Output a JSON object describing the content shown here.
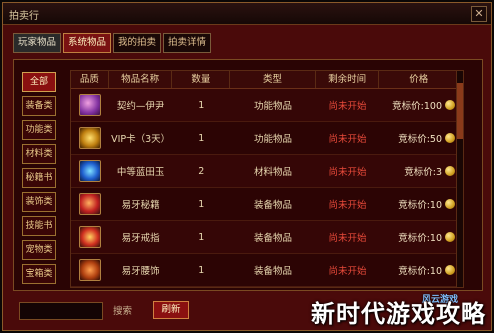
{
  "window": {
    "title": "拍卖行",
    "close": "✕"
  },
  "tabs": [
    "玩家物品",
    "系统物品",
    "我的拍卖",
    "拍卖详情"
  ],
  "categories": [
    "全部",
    "装备类",
    "功能类",
    "材料类",
    "秘籍书",
    "装饰类",
    "技能书",
    "宠物类",
    "宝箱类"
  ],
  "table": {
    "headers": [
      "品质",
      "物品名称",
      "数量",
      "类型",
      "剩余时间",
      "价格"
    ],
    "rows": [
      {
        "icon": "purple-bow-icon",
        "name": "契约—伊尹",
        "qty": "1",
        "type": "功能物品",
        "time": "尚未开始",
        "price": "竞标价:100"
      },
      {
        "icon": "vip-card-icon",
        "name": "VIP卡（3天）",
        "qty": "1",
        "type": "功能物品",
        "time": "尚未开始",
        "price": "竞标价:50"
      },
      {
        "icon": "blue-jade-icon",
        "name": "中等蓝田玉",
        "qty": "2",
        "type": "材料物品",
        "time": "尚未开始",
        "price": "竞标价:3"
      },
      {
        "icon": "armor-icon",
        "name": "易牙秘籍",
        "qty": "1",
        "type": "装备物品",
        "time": "尚未开始",
        "price": "竞标价:10"
      },
      {
        "icon": "ring-icon",
        "name": "易牙戒指",
        "qty": "1",
        "type": "装备物品",
        "time": "尚未开始",
        "price": "竞标价:10"
      },
      {
        "icon": "ornament-icon",
        "name": "易牙腰饰",
        "qty": "1",
        "type": "装备物品",
        "time": "尚未开始",
        "price": "竞标价:10"
      }
    ]
  },
  "footer": {
    "search_label": "搜索",
    "refresh_label": "刷新"
  },
  "watermark": {
    "main": "新时代游戏攻略",
    "sub": "风云游戏"
  },
  "colors": {
    "accent": "#8a1010",
    "status": "#e84a3a"
  }
}
